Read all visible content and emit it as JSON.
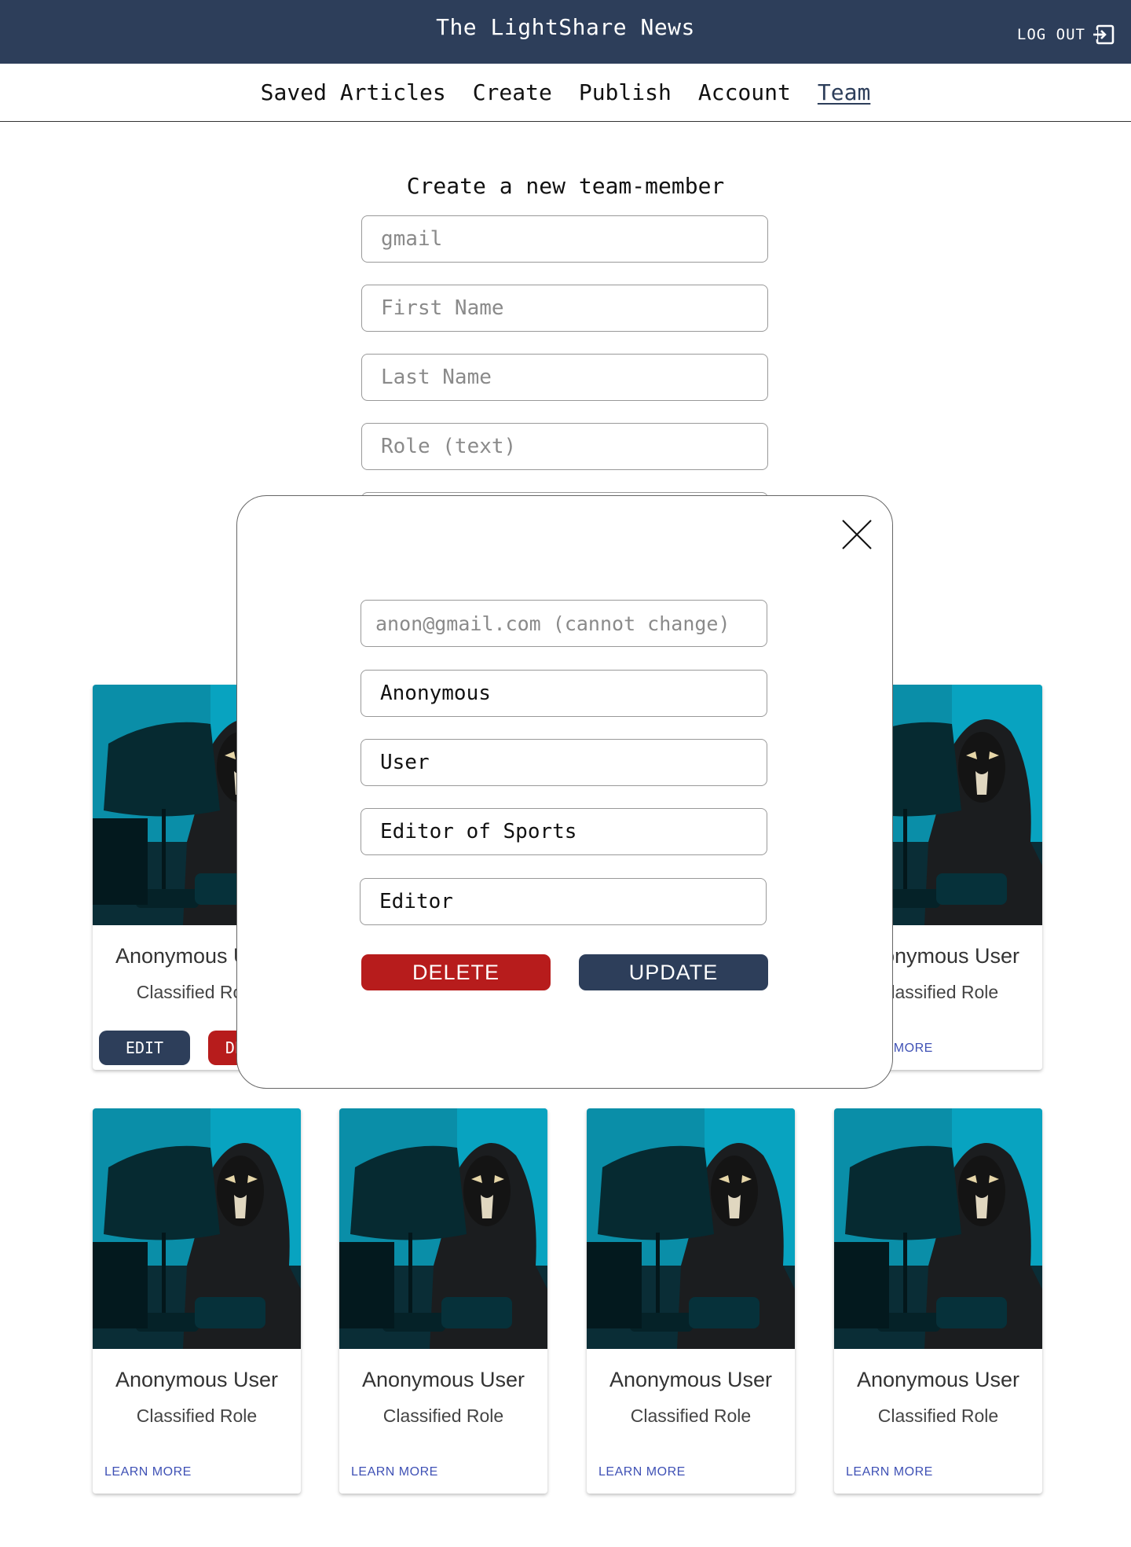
{
  "header": {
    "title": "The LightShare News",
    "logout_label": "LOG OUT"
  },
  "nav": {
    "items": [
      {
        "label": "Saved Articles"
      },
      {
        "label": "Create"
      },
      {
        "label": "Publish"
      },
      {
        "label": "Account"
      },
      {
        "label": "Team",
        "active": true
      }
    ]
  },
  "create_form": {
    "title": "Create a new team-member",
    "gmail_placeholder": "gmail",
    "first_name_placeholder": "First Name",
    "last_name_placeholder": "Last Name",
    "role_placeholder": "Role (text)"
  },
  "modal": {
    "email_placeholder": "anon@gmail.com (cannot change)",
    "first_name_value": "Anonymous",
    "last_name_value": "User",
    "role_value": "Editor of Sports",
    "permission_value": "Editor",
    "delete_label": "DELETE",
    "update_label": "UPDATE"
  },
  "cards_row1": {
    "left": {
      "name": "Anonymous User",
      "role": "Classified Role",
      "edit_label": "EDIT",
      "delete_label": "DELETE"
    },
    "right": {
      "name": "Anonymous User",
      "role": "Classified Role",
      "learn_label": "LEARN MORE"
    }
  },
  "cards_row2": [
    {
      "name": "Anonymous User",
      "role": "Classified Role",
      "learn_label": "LEARN MORE"
    },
    {
      "name": "Anonymous User",
      "role": "Classified Role",
      "learn_label": "LEARN MORE"
    },
    {
      "name": "Anonymous User",
      "role": "Classified Role",
      "learn_label": "LEARN MORE"
    },
    {
      "name": "Anonymous User",
      "role": "Classified Role",
      "learn_label": "LEARN MORE"
    }
  ],
  "colors": {
    "primary": "#2d3e5a",
    "danger": "#b71c1c",
    "link": "#3f51b5"
  }
}
